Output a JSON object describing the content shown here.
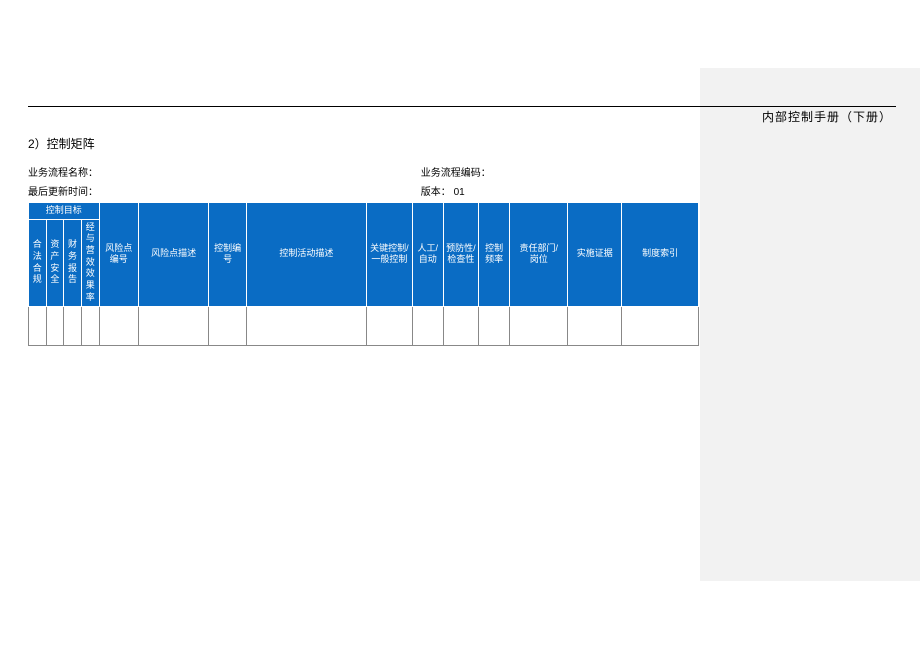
{
  "book_title": "内部控制手册（下册）",
  "section_title": "2）控制矩阵",
  "meta": {
    "process_name_label": "业务流程名称：",
    "process_name_value": "",
    "process_code_label": "业务流程编码：",
    "process_code_value": "",
    "update_time_label": "最后更新时间：",
    "update_time_value": "",
    "version_label": "版本：",
    "version_value": "01"
  },
  "table": {
    "header": {
      "control_objective": "控制目标",
      "compliance": "合法合规",
      "asset_safety": "资产安全",
      "financial_report": "财务报告",
      "efficiency": "经与营效效果率",
      "risk_no": "风险点编号",
      "risk_desc": "风险点描述",
      "control_no": "控制编号",
      "control_desc": "控制活动描述",
      "key_control_l1": "关键控制/",
      "key_control_l2": "一般控制",
      "manual_l1": "人工/",
      "manual_l2": "自动",
      "preventive_l1": "预防性/",
      "preventive_l2": "检查性",
      "freq_l1": "控制",
      "freq_l2": "频率",
      "dept_l1": "责任部门/",
      "dept_l2": "岗位",
      "evidence": "实施证据",
      "system_index": "制度索引"
    },
    "rows": [
      {
        "compliance": "",
        "asset_safety": "",
        "financial_report": "",
        "efficiency": "",
        "risk_no": "",
        "risk_desc": "",
        "control_no": "",
        "control_desc": "",
        "key_control": "",
        "manual": "",
        "preventive": "",
        "freq": "",
        "dept": "",
        "evidence": "",
        "system_index": ""
      }
    ]
  }
}
